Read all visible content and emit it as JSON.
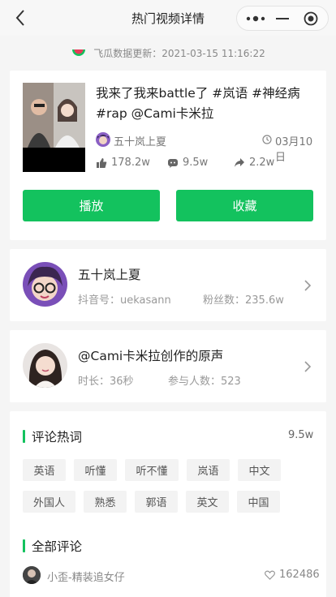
{
  "nav": {
    "title": "热门视频详情"
  },
  "update_text": "飞瓜数据更新：2021-03-15 11:16:22",
  "video": {
    "title": "我来了我来battle了 #岚语 #神经病 #rap @Cami卡米拉",
    "author": "五十岚上夏",
    "date": "03月10日",
    "likes": "178.2w",
    "comments": "9.5w",
    "shares": "2.2w"
  },
  "buttons": {
    "play": "播放",
    "favorite": "收藏"
  },
  "creator": {
    "name": "五十岚上夏",
    "douyin_id": "抖音号：uekasann",
    "fans": "粉丝数：235.6w"
  },
  "music": {
    "title": "@Cami卡米拉创作的原声",
    "duration": "时长：36秒",
    "participants": "参与人数：523"
  },
  "hot_words": {
    "title": "评论热词",
    "count": "9.5w",
    "tags": [
      "英语",
      "听懂",
      "听不懂",
      "岚语",
      "中文",
      "外国人",
      "熟悉",
      "郭语",
      "英文",
      "中国"
    ]
  },
  "all_comments": {
    "title": "全部评论",
    "first": {
      "user": "小歪-精装追女仔",
      "likes": "162486"
    }
  },
  "colors": {
    "accent": "#13c25e"
  },
  "icons": [
    "back-icon",
    "more-icon",
    "minimize-icon",
    "close-icon",
    "clock-icon",
    "thumb-up-icon",
    "comment-icon",
    "share-icon",
    "chevron-right-icon",
    "heart-icon"
  ]
}
